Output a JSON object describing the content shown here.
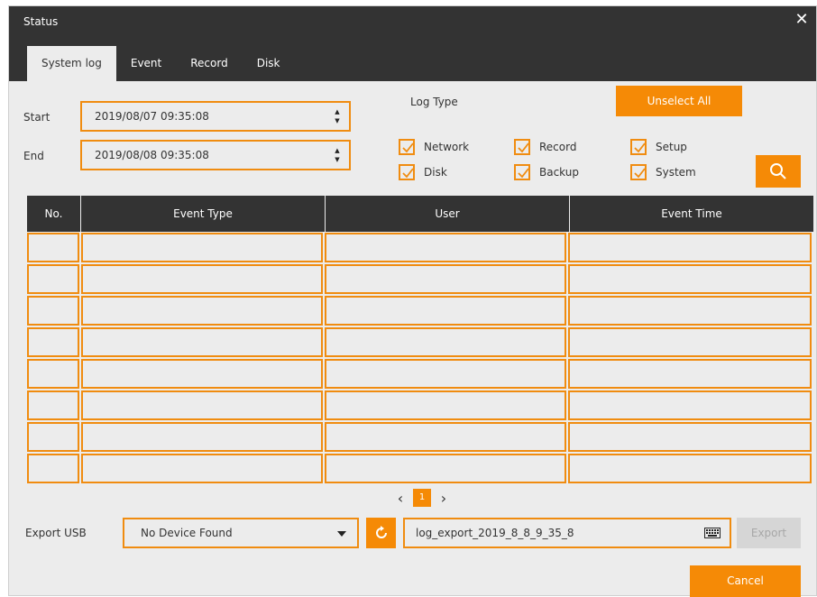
{
  "window": {
    "title": "Status",
    "close_glyph": "✕"
  },
  "tabs": [
    {
      "label": "System log",
      "active": true
    },
    {
      "label": "Event",
      "active": false
    },
    {
      "label": "Record",
      "active": false
    },
    {
      "label": "Disk",
      "active": false
    }
  ],
  "filter": {
    "start_label": "Start",
    "start_value": "2019/08/07 09:35:08",
    "end_label": "End",
    "end_value": "2019/08/08 09:35:08",
    "log_type_label": "Log Type",
    "unselect_all_label": "Unselect All",
    "log_types": [
      {
        "label": "Network",
        "checked": true
      },
      {
        "label": "Record",
        "checked": true
      },
      {
        "label": "Setup",
        "checked": true
      },
      {
        "label": "Disk",
        "checked": true
      },
      {
        "label": "Backup",
        "checked": true
      },
      {
        "label": "System",
        "checked": true
      }
    ],
    "search_icon": "search-icon"
  },
  "table": {
    "columns": [
      "No.",
      "Event Type",
      "User",
      "Event Time"
    ],
    "rows": [
      [
        "",
        "",
        "",
        ""
      ],
      [
        "",
        "",
        "",
        ""
      ],
      [
        "",
        "",
        "",
        ""
      ],
      [
        "",
        "",
        "",
        ""
      ],
      [
        "",
        "",
        "",
        ""
      ],
      [
        "",
        "",
        "",
        ""
      ],
      [
        "",
        "",
        "",
        ""
      ],
      [
        "",
        "",
        "",
        ""
      ]
    ]
  },
  "pagination": {
    "prev": "‹",
    "current_page": "1",
    "next": "›"
  },
  "export": {
    "label": "Export USB",
    "device_value": "No Device Found",
    "refresh_icon": "refresh-icon",
    "filename": "log_export_2019_8_8_9_35_8",
    "keyboard_icon": "keyboard-icon",
    "export_label": "Export"
  },
  "footer": {
    "cancel_label": "Cancel"
  },
  "colors": {
    "accent": "#f58a06",
    "header_bg": "#333333",
    "panel_bg": "#ececec"
  }
}
